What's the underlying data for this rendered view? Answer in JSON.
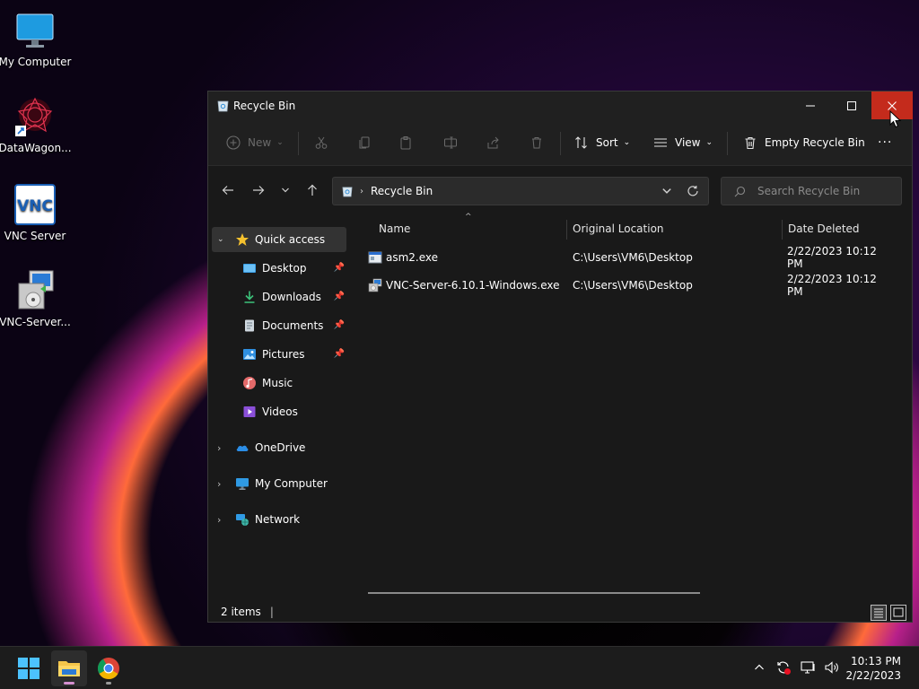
{
  "desktop": {
    "icons": [
      {
        "label": "My Computer"
      },
      {
        "label": "DataWagon..."
      },
      {
        "label": "VNC Server"
      },
      {
        "label": "VNC-Server..."
      }
    ]
  },
  "window": {
    "title": "Recycle Bin",
    "toolbar": {
      "new_label": "New",
      "sort_label": "Sort",
      "view_label": "View",
      "empty_label": "Empty Recycle Bin",
      "more_label": "···"
    },
    "address": {
      "path": "Recycle Bin",
      "search_placeholder": "Search Recycle Bin"
    },
    "nav": {
      "quick_access": "Quick access",
      "items": [
        {
          "label": "Desktop",
          "pinned": true
        },
        {
          "label": "Downloads",
          "pinned": true
        },
        {
          "label": "Documents",
          "pinned": true
        },
        {
          "label": "Pictures",
          "pinned": true
        },
        {
          "label": "Music",
          "pinned": false
        },
        {
          "label": "Videos",
          "pinned": false
        }
      ],
      "groups": [
        {
          "label": "OneDrive"
        },
        {
          "label": "My Computer"
        },
        {
          "label": "Network"
        }
      ]
    },
    "columns": {
      "name": "Name",
      "original_location": "Original Location",
      "date_deleted": "Date Deleted"
    },
    "files": [
      {
        "name": "asm2.exe",
        "location": "C:\\Users\\VM6\\Desktop",
        "date": "2/22/2023 10:12 PM"
      },
      {
        "name": "VNC-Server-6.10.1-Windows.exe",
        "location": "C:\\Users\\VM6\\Desktop",
        "date": "2/22/2023 10:12 PM"
      }
    ],
    "status": {
      "count": "2 items"
    }
  },
  "taskbar": {
    "time": "10:13 PM",
    "date": "2/22/2023"
  },
  "colors": {
    "close_red": "#c42b1c",
    "window_bg": "#191919",
    "accent_pink": "#d58fd0"
  }
}
